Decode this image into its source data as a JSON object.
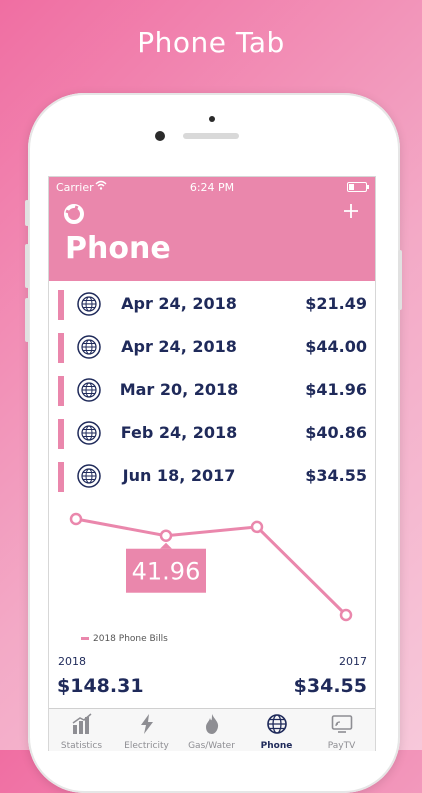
{
  "promo_title": "Phone Tab",
  "status_bar": {
    "carrier": "Carrier",
    "time": "6:24 PM"
  },
  "header": {
    "title": "Phone"
  },
  "bills": [
    {
      "date": "Apr 24, 2018",
      "amount": "$21.49"
    },
    {
      "date": "Apr 24, 2018",
      "amount": "$44.00"
    },
    {
      "date": "Mar 20, 2018",
      "amount": "$41.96"
    },
    {
      "date": "Feb 24, 2018",
      "amount": "$40.86"
    },
    {
      "date": "Jun 18, 2017",
      "amount": "$34.55"
    }
  ],
  "chart_data": {
    "type": "line",
    "series": [
      {
        "name": "2018 Phone Bills",
        "values": [
          44.0,
          41.96,
          40.86,
          34.55
        ]
      }
    ],
    "selected_value": "41.96",
    "color": "#ea87ac"
  },
  "summary": {
    "left_year": "2018",
    "left_total": "$148.31",
    "right_year": "2017",
    "right_total": "$34.55"
  },
  "tabs": [
    {
      "label": "Statistics",
      "icon": "statistics-icon",
      "active": false
    },
    {
      "label": "Electricity",
      "icon": "lightning-icon",
      "active": false
    },
    {
      "label": "Gas/Water",
      "icon": "flame-icon",
      "active": false
    },
    {
      "label": "Phone",
      "icon": "globe-icon",
      "active": true
    },
    {
      "label": "PayTV",
      "icon": "tv-icon",
      "active": false
    }
  ],
  "colors": {
    "accent": "#ea87ac",
    "text": "#1f2a5a"
  }
}
